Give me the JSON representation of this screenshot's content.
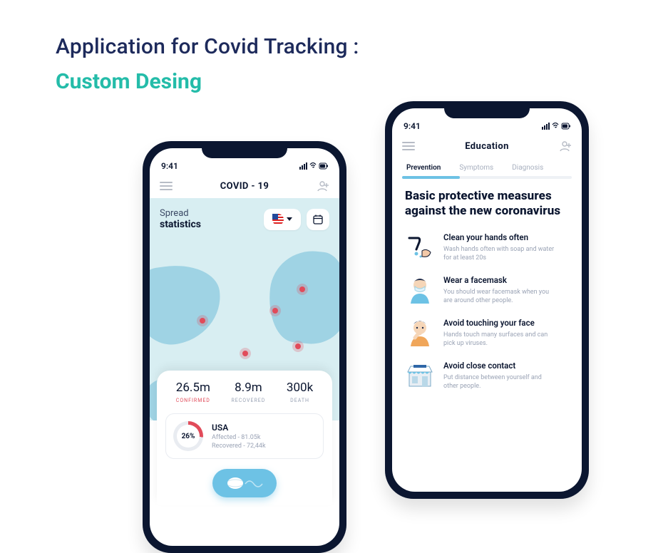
{
  "heading": {
    "line1": "Application for Covid Tracking :",
    "line2": "Custom Desing"
  },
  "status_time": "9:41",
  "phone1": {
    "app_title": "COVID - 19",
    "spread_label": "Spread",
    "spread_bold": "statistics",
    "country_picker": {
      "selected": "USA"
    },
    "stats": [
      {
        "value": "26.5m",
        "label": "CONFIRMED",
        "variant": "red"
      },
      {
        "value": "8.9m",
        "label": "RECOVERED"
      },
      {
        "value": "300k",
        "label": "DEATH"
      }
    ],
    "country_card": {
      "percent": "26%",
      "name": "USA",
      "affected": "Affected - 81.05k",
      "recovered": "Recovered - 72,44k"
    }
  },
  "phone2": {
    "app_title": "Education",
    "tabs": [
      {
        "label": "Prevention",
        "active": true
      },
      {
        "label": "Symptoms"
      },
      {
        "label": "Diagnosis"
      }
    ],
    "heading": "Basic protective measures against the new coronavirus",
    "tips": [
      {
        "title": "Clean your hands often",
        "sub": "Wash hands often with soap and water for at least 20s"
      },
      {
        "title": "Wear a facemask",
        "sub": "You should wear facemask when you are around other people."
      },
      {
        "title": "Avoid touching your face",
        "sub": "Hands touch many surfaces and can pick up viruses."
      },
      {
        "title": "Avoid close contact",
        "sub": "Put distance between yourself and other people."
      }
    ]
  }
}
